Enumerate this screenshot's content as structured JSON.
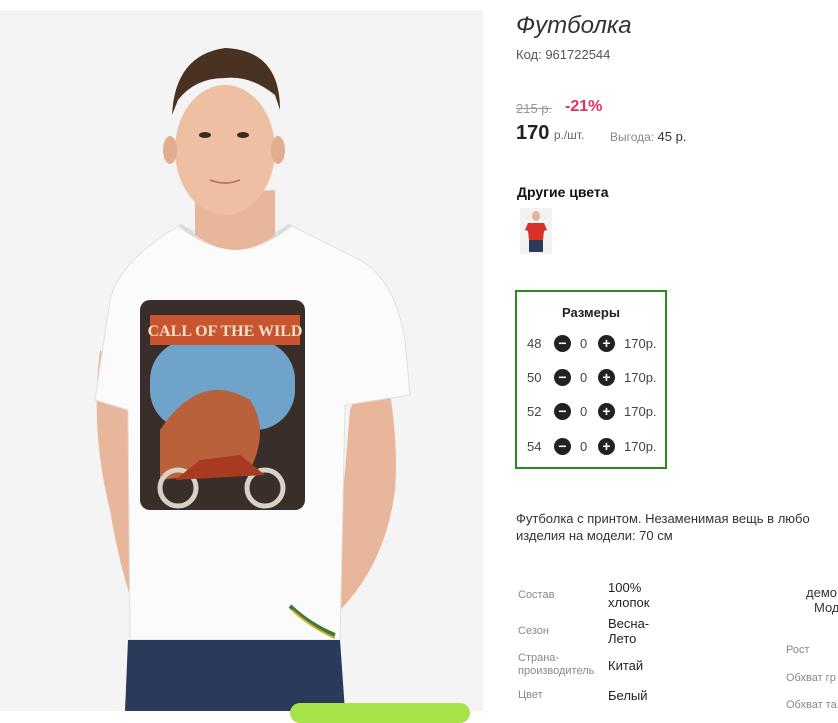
{
  "product": {
    "title": "Футболка",
    "code": "Код: 961722544",
    "old_price": "215 р.",
    "discount": "-21%",
    "price": "170",
    "price_unit": "р./шт.",
    "benefit_label": "Выгода:",
    "benefit_value": "45 р."
  },
  "other_colors": {
    "title": "Другие цвета"
  },
  "sizes": {
    "title": "Размеры",
    "rows": [
      {
        "size": "48",
        "qty": "0",
        "price": "170р."
      },
      {
        "size": "50",
        "qty": "0",
        "price": "170р."
      },
      {
        "size": "52",
        "qty": "0",
        "price": "170р."
      },
      {
        "size": "54",
        "qty": "0",
        "price": "170р."
      }
    ],
    "minus_symbol": "−",
    "plus_symbol": "+"
  },
  "description": {
    "line1": "Футболка с принтом. Незаменимая вещь в любо",
    "line2": "изделия на модели: 70 см"
  },
  "specs": [
    {
      "label": "Состав",
      "value": "100% хлопок"
    },
    {
      "label": "Сезон",
      "value": "Весна-Лето"
    },
    {
      "label": "Страна-производитель",
      "value": "Китай"
    },
    {
      "label": "Цвет",
      "value": "Белый"
    }
  ],
  "model_info": {
    "header_line1": "демо",
    "header_line2": "Мод",
    "rows": [
      "Рост",
      "Обхват гр",
      "Обхват та"
    ]
  },
  "colors": {
    "accent_green": "#2b8a1e",
    "discount_red": "#e0305f"
  }
}
